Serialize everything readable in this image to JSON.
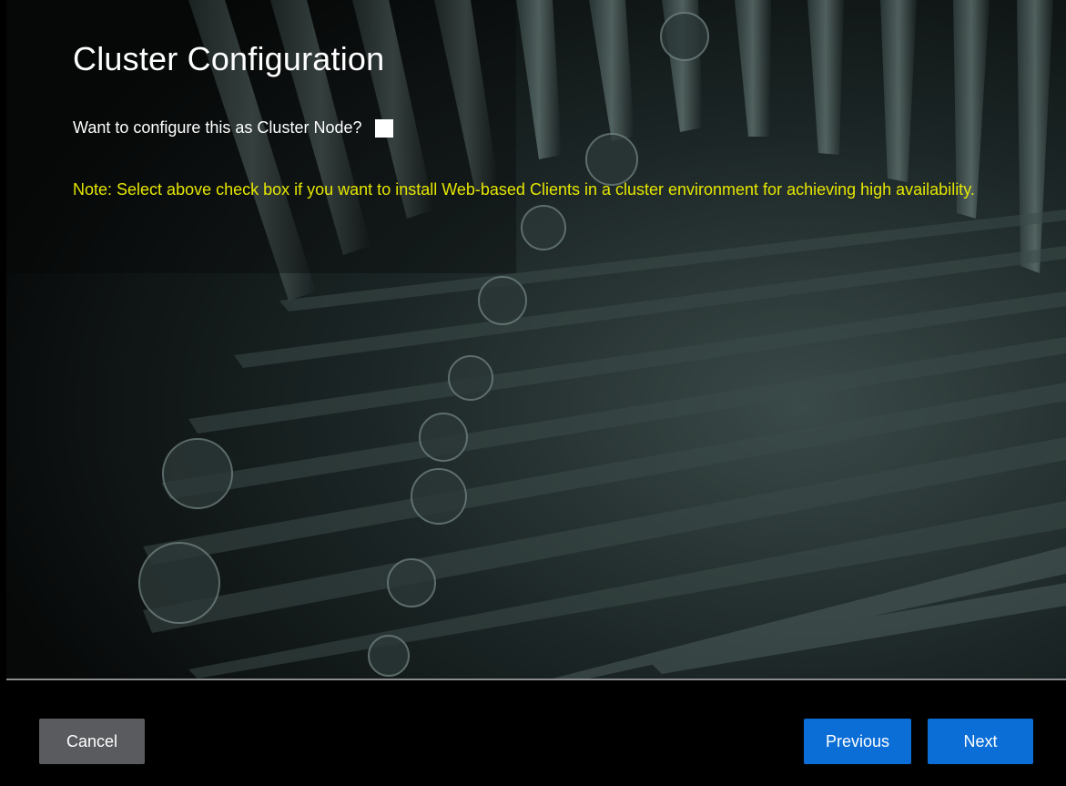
{
  "page": {
    "title": "Cluster Configuration",
    "question_label": "Want to configure this as Cluster Node?",
    "checkbox_checked": false,
    "note": "Note: Select above check box if you want to install Web-based Clients in a cluster environment for achieving high availability."
  },
  "footer": {
    "cancel_label": "Cancel",
    "previous_label": "Previous",
    "next_label": "Next"
  },
  "colors": {
    "background": "#000000",
    "title_text": "#ffffff",
    "note_text": "#e5e600",
    "primary_button": "#0b6ed6",
    "secondary_button": "#595b5e"
  }
}
